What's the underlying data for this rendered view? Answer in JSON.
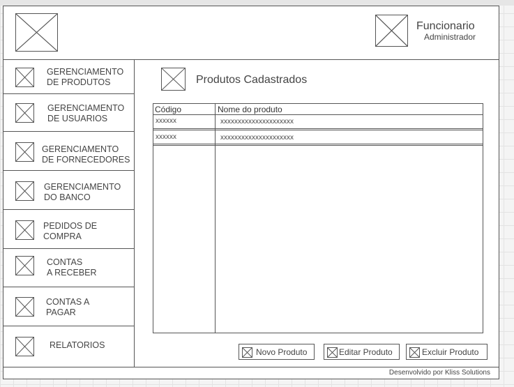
{
  "header": {
    "user_name": "Funcionario",
    "user_role": "Administrador",
    "logo_icon": "image-placeholder-icon",
    "avatar_icon": "image-placeholder-icon"
  },
  "sidebar": {
    "items": [
      {
        "label": "GERENCIAMENTO\nDE PRODUTOS",
        "icon": "image-placeholder-icon"
      },
      {
        "label": "GERENCIAMENTO\nDE USUARIOS",
        "icon": "image-placeholder-icon"
      },
      {
        "label": "GERENCIAMENTO\nDE FORNECEDORES",
        "icon": "image-placeholder-icon"
      },
      {
        "label": "GERENCIAMENTO\nDO BANCO",
        "icon": "image-placeholder-icon"
      },
      {
        "label": "PEDIDOS DE\nCOMPRA",
        "icon": "image-placeholder-icon"
      },
      {
        "label": "CONTAS\nA RECEBER",
        "icon": "image-placeholder-icon"
      },
      {
        "label": "CONTAS A\nPAGAR",
        "icon": "image-placeholder-icon"
      },
      {
        "label": "RELATORIOS",
        "icon": "image-placeholder-icon"
      }
    ]
  },
  "main": {
    "title": "Produtos Cadastrados",
    "table": {
      "columns": [
        "Código",
        "Nome do produto"
      ],
      "rows": [
        [
          "xxxxxx",
          "xxxxxxxxxxxxxxxxxxxxx"
        ],
        [
          "xxxxxx",
          "xxxxxxxxxxxxxxxxxxxxx"
        ]
      ]
    },
    "buttons": {
      "new": "Novo Produto",
      "edit": "Editar Produto",
      "delete": "Excluir Produto"
    }
  },
  "footer": {
    "text": "Desenvolvido por Kliss Solutions"
  }
}
